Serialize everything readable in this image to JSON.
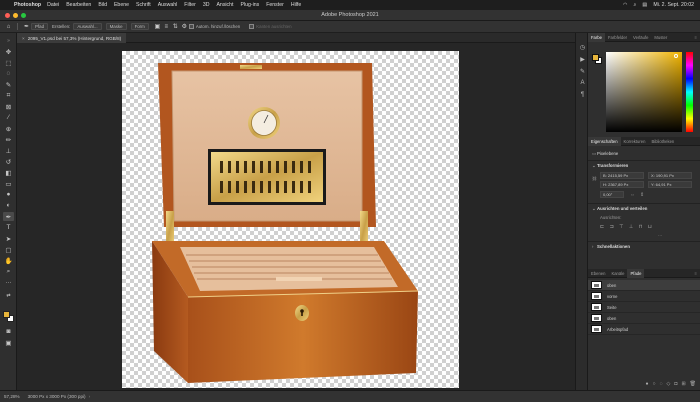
{
  "menubar": {
    "apple": "",
    "app": "Photoshop",
    "items": [
      "Datei",
      "Bearbeiten",
      "Bild",
      "Ebene",
      "Schrift",
      "Auswahl",
      "Filter",
      "3D",
      "Ansicht",
      "Plug-ins",
      "Fenster",
      "Hilfe"
    ],
    "clock": "Mi. 2. Sept. 20:02"
  },
  "window": {
    "title": "Adobe Photoshop 2021"
  },
  "options": {
    "mode_select": "Pfad",
    "make_label": "Erstellen:",
    "selection_label": "Auswahl...",
    "mask_label": "Maske",
    "shape_label": "Form",
    "auto_add_label": "Autom. hinzuf./löschen",
    "align_edges_label": "Kanten ausrichten"
  },
  "document": {
    "tab_title": "2095_V1.psd bei 57,3% (Hintergrund, RGB/8)",
    "close": "×"
  },
  "status": {
    "zoom": "57,28%",
    "doc_info": "3000 Px x 3000 Px (300 ppi)",
    "arrow": "›"
  },
  "panels": {
    "color_tabs": [
      "Farbe",
      "Farbfelder",
      "Verläufe",
      "Muster"
    ],
    "props_tabs": [
      "Eigenschaften",
      "Korrekturen",
      "Bibliotheken"
    ],
    "props": {
      "layer_type": "Pixelebene",
      "transform_header": "Transformieren",
      "w": "B: 2415,59 Px",
      "x": "X: 190,91 Px",
      "h": "H: 2367,89 Px",
      "y": "Y: 64,91 Px",
      "angle": "0,00°",
      "align_header": "Ausrichten und verteilen",
      "align_sub": "Ausrichten:",
      "more_header": "Schnellaktionen"
    },
    "paths_tabs": [
      "Ebenen",
      "Kanäle",
      "Pfade"
    ],
    "paths": [
      "oben",
      "vorne",
      "Seite",
      "oben",
      "Arbeitspfad"
    ],
    "panel_menu": "≡"
  },
  "colors": {
    "foreground": "#e6b43a",
    "background": "#ffffff",
    "accent": "#31a8ff"
  }
}
